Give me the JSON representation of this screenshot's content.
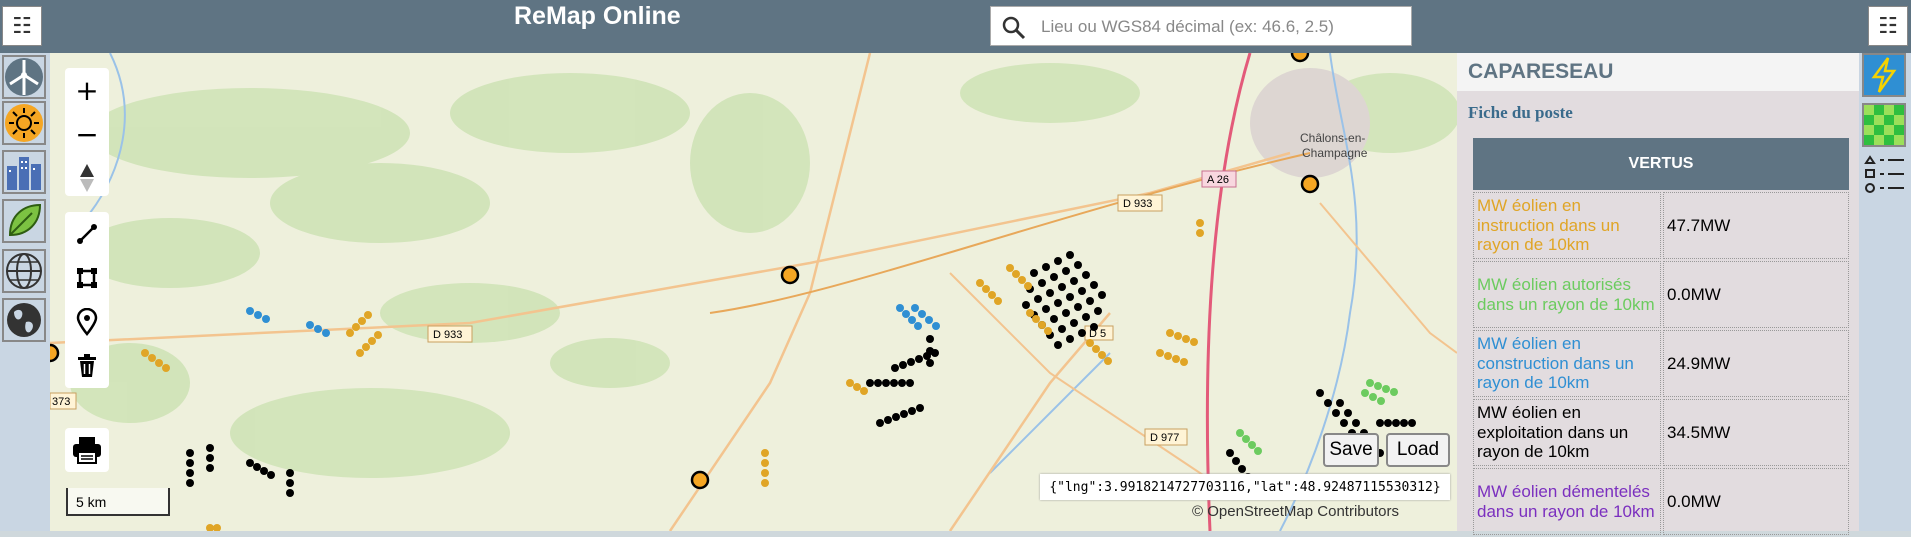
{
  "header": {
    "title": "ReMap Online",
    "search_placeholder": "Lieu ou WGS84 décimal (ex: 46.6, 2.5)",
    "left_menu_icon": "menu-grid-icon",
    "right_menu_icon": "menu-grid-icon"
  },
  "map": {
    "scale_label": "5 km",
    "coordinates": "{\"lng\":3.9918214727703116,\"lat\":48.92487115530312}",
    "attribution": "© OpenStreetMap Contributors",
    "save_label": "Save",
    "load_label": "Load",
    "place_labels": [
      "Châlons-en-",
      "Champagne"
    ],
    "road_labels": [
      "D 933",
      "D 933",
      "A 26",
      "D 5",
      "D 977",
      "373"
    ],
    "controls": [
      "zoom-in-icon",
      "zoom-out-icon",
      "compass-icon",
      "draw-line-icon",
      "draw-polygon-icon",
      "marker-icon",
      "trash-icon",
      "print-icon"
    ],
    "layer_buttons": [
      "wind-turbine-icon",
      "sun-icon",
      "buildings-icon",
      "leaf-icon",
      "globe-grid-icon",
      "earth-icon"
    ],
    "colors": {
      "instruction": "#e0a526",
      "autorise": "#6ccb5f",
      "construction": "#2f8fd3",
      "exploitation": "#000000",
      "poste": "#f5a623"
    }
  },
  "panel": {
    "title": "CAPARESEAU",
    "subtitle": "Fiche du poste",
    "table_header": "VERTUS",
    "rows": [
      {
        "label": "MW éolien en instruction dans un rayon de 10km",
        "value": "47.7MW",
        "color": "#e0a526"
      },
      {
        "label": "MW éolien autorisés dans un rayon de 10km",
        "value": "0.0MW",
        "color": "#6ccb5f"
      },
      {
        "label": "MW éolien en construction dans un rayon de 10km",
        "value": "24.9MW",
        "color": "#2f8fd3"
      },
      {
        "label": "MW éolien en exploitation dans un rayon de 10km",
        "value": "34.5MW",
        "color": "#000000"
      },
      {
        "label": "MW éolien démentelés dans un rayon de 10km",
        "value": "0.0MW",
        "color": "#7b2fbf"
      }
    ]
  },
  "right_toolbar": [
    "lightning-icon",
    "grid-layer-icon",
    "legend-list-icon"
  ]
}
